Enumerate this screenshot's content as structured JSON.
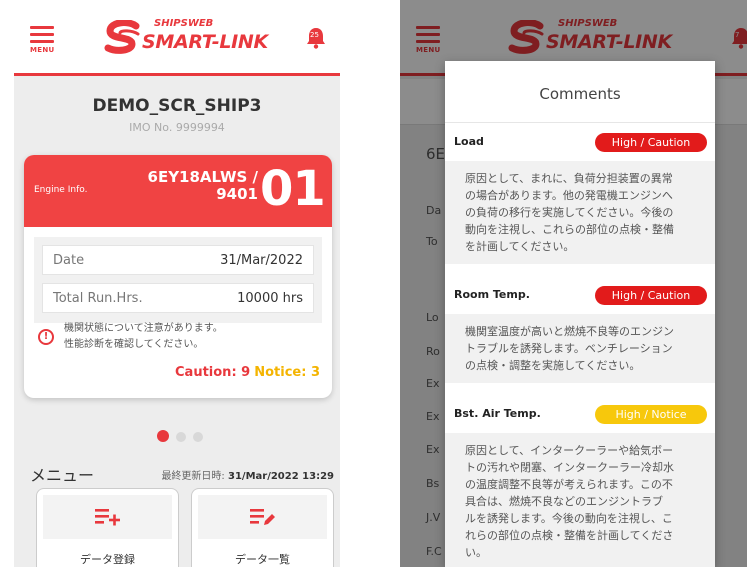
{
  "left": {
    "menu_label": "MENU",
    "brand_top": "SHIPSWEB",
    "brand_main": "SMART-LINK",
    "notification_count": "25",
    "ship_name": "DEMO_SCR_SHIP3",
    "imo": "IMO No. 9999994",
    "engine_label": "Engine Info.",
    "engine_model_line1": "6EY18ALWS /",
    "engine_model_line2": "9401",
    "engine_number": "01",
    "date_label": "Date",
    "date_value": "31/Mar/2022",
    "runhrs_label": "Total Run.Hrs.",
    "runhrs_value": "10000 hrs",
    "warning_line1": "機関状態について注意があります。",
    "warning_line2": "性能診断を確認してください。",
    "caution_text": "Caution: 9",
    "notice_text": "Notice: 3",
    "menu_heading": "メニュー",
    "updated_label": "最終更新日時:",
    "updated_value": "31/Mar/2022 13:29",
    "tile_register": "データ登録",
    "tile_list": "データ一覧"
  },
  "right": {
    "menu_label": "MENU",
    "brand_top": "SHIPSWEB",
    "brand_main": "SMART-LINK",
    "notification_count": "7",
    "ghost": [
      "6E",
      "Da",
      "To",
      "Lo",
      "Ro",
      "Ex",
      "Ex",
      "Ex",
      "Bs",
      "J.V",
      "F.C"
    ],
    "dialog_title": "Comments",
    "sections": [
      {
        "name": "Load",
        "level": "High / Caution",
        "lines": [
          "原因として、まれに、負荷分担装置の異常",
          "の場合があります。他の発電機エンジンへ",
          "の負荷の移行を実施してください。今後の",
          "動向を注視し、これらの部位の点検・整備",
          "を計画してください。"
        ]
      },
      {
        "name": "Room Temp.",
        "level": "High / Caution",
        "lines": [
          "機関室温度が高いと燃焼不良等のエンジン",
          "トラブルを誘発します。ベンチレーション",
          "の点検・調整を実施してください。"
        ]
      },
      {
        "name": "Bst. Air Temp.",
        "level": "High / Notice",
        "lines": [
          "原因として、インタークーラーや給気ボー",
          "トの汚れや閉塞、インタークーラー冷却水",
          "の温度調整不良等が考えられます。この不",
          "具合は、燃焼不良などのエンジントラブ",
          "ルを誘発します。今後の動向を注視し、こ",
          "れらの部位の点検・整備を計画してくださ",
          "い。"
        ]
      }
    ]
  },
  "colors": {
    "brand_red": "#e8383d",
    "notice_yellow": "#f7c80c",
    "caution_red": "#e21b1b"
  }
}
